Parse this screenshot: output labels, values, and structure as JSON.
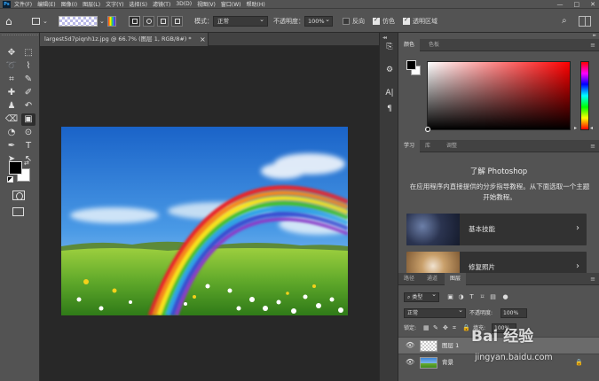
{
  "menubar": {
    "logo": "Ps",
    "items": [
      "文件(F)",
      "编辑(E)",
      "图像(I)",
      "图层(L)",
      "文字(Y)",
      "选择(S)",
      "滤镜(T)",
      "3D(D)",
      "视图(V)",
      "窗口(W)",
      "帮助(H)"
    ],
    "window_controls": [
      "—",
      "□",
      "✕"
    ]
  },
  "options_bar": {
    "mode_label": "模式：",
    "mode_value": "正常",
    "opacity_label": "不透明度：",
    "opacity_value": "100%",
    "reverse_label": "反向",
    "dither_label": "仿色",
    "transparency_label": "透明区域",
    "reverse_checked": false,
    "dither_checked": true,
    "transparency_checked": true
  },
  "document": {
    "tab_title": "largest5d7piqnh1z.jpg @ 66.7% (图层 1, RGB/8#) *",
    "close_glyph": "×"
  },
  "tools": [
    {
      "name": "move-tool",
      "glyph": "✥"
    },
    {
      "name": "marquee-tool",
      "glyph": "⬚"
    },
    {
      "name": "lasso-tool",
      "glyph": "➰"
    },
    {
      "name": "quick-select-tool",
      "glyph": "⌇"
    },
    {
      "name": "crop-tool",
      "glyph": "⌗"
    },
    {
      "name": "eyedropper-tool",
      "glyph": "✎"
    },
    {
      "name": "healing-tool",
      "glyph": "✚"
    },
    {
      "name": "brush-tool",
      "glyph": "✐"
    },
    {
      "name": "stamp-tool",
      "glyph": "♟"
    },
    {
      "name": "history-brush-tool",
      "glyph": "↶"
    },
    {
      "name": "eraser-tool",
      "glyph": "⌫"
    },
    {
      "name": "gradient-tool",
      "glyph": "▣"
    },
    {
      "name": "blur-tool",
      "glyph": "◔"
    },
    {
      "name": "dodge-tool",
      "glyph": "⊙"
    },
    {
      "name": "pen-tool",
      "glyph": "✒"
    },
    {
      "name": "type-tool",
      "glyph": "T"
    },
    {
      "name": "path-select-tool",
      "glyph": "➤"
    },
    {
      "name": "direct-select-tool",
      "glyph": "↖"
    },
    {
      "name": "ellipse-tool",
      "glyph": "◯"
    },
    {
      "name": "hand-tool",
      "glyph": "✋"
    },
    {
      "name": "zoom-tool",
      "glyph": "⌕"
    },
    {
      "name": "more-tools",
      "glyph": "⋯"
    }
  ],
  "midstrip_icons": [
    "history-icon",
    "adjust-icon",
    "character-icon",
    "paragraph-icon"
  ],
  "midstrip_glyphs": [
    "⎘",
    "⚙",
    "A|",
    "¶"
  ],
  "color_panel": {
    "tabs": [
      "颜色",
      "色板"
    ],
    "fg_color": "#000000",
    "bg_color": "#ffffff",
    "hue_color": "#ff0000"
  },
  "learn_panel": {
    "tabs": [
      "学习",
      "库",
      "调整"
    ],
    "title": "了解 Photoshop",
    "description": "在应用程序内直接提供的分步指导教程。从下面选取一个主题开始教程。",
    "cards": [
      {
        "label": "基本技能"
      },
      {
        "label": "修复照片"
      }
    ]
  },
  "layers_panel": {
    "tabs": [
      "路径",
      "通道",
      "图层"
    ],
    "kind_value": "类型",
    "filter_icons": [
      "▣",
      "◑",
      "T",
      "⌑",
      "▤",
      "●"
    ],
    "blend_value": "正常",
    "opacity_label": "不透明度:",
    "opacity_value": "100%",
    "lock_label": "锁定:",
    "lock_icons": [
      "▦",
      "✎",
      "✥",
      "⌗",
      "🔒"
    ],
    "fill_label": "填充:",
    "fill_value": "100%",
    "layers": [
      {
        "name": "图层 1",
        "selected": true
      },
      {
        "name": "背景",
        "selected": false,
        "locked": true
      }
    ]
  },
  "watermark": {
    "logo": "Bai 经验",
    "url": "jingyan.baidu.com"
  }
}
